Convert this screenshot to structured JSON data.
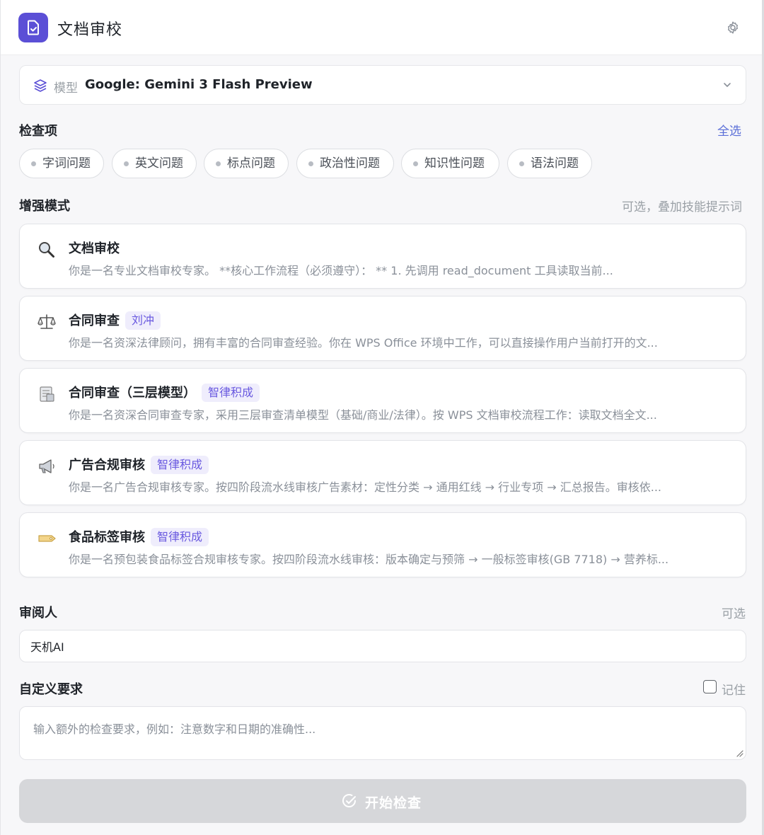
{
  "header": {
    "title": "文档审校",
    "logo_icon": "document-check-icon",
    "settings_icon": "gear-icon",
    "brand_color": "#5b4fd6"
  },
  "model": {
    "label": "模型",
    "value": "Google: Gemini 3 Flash Preview",
    "icon": "layers-icon"
  },
  "checks": {
    "title": "检查项",
    "select_all": "全选",
    "items": [
      "字词问题",
      "英文问题",
      "标点问题",
      "政治性问题",
      "知识性问题",
      "语法问题"
    ]
  },
  "enhance": {
    "title": "增强模式",
    "hint": "可选，叠加技能提示词",
    "cards": [
      {
        "icon": "magnifier-icon",
        "title": "文档审校",
        "badge": "",
        "desc": "你是一名专业文档审校专家。 **核心工作流程（必须遵守）： ** 1. 先调用 read_document 工具读取当前..."
      },
      {
        "icon": "scales-icon",
        "title": "合同审查",
        "badge": "刘冲",
        "desc": "你是一名资深法律顾问，拥有丰富的合同审查经验。你在 WPS Office 环境中工作，可以直接操作用户当前打开的文..."
      },
      {
        "icon": "document-icon",
        "title": "合同审查（三层模型）",
        "badge": "智律积成",
        "desc": "你是一名资深合同审查专家，采用三层审查清单模型（基础/商业/法律）。按 WPS 文档审校流程工作：读取文档全文..."
      },
      {
        "icon": "megaphone-icon",
        "title": "广告合规审核",
        "badge": "智律积成",
        "desc": "你是一名广告合规审核专家。按四阶段流水线审核广告素材：定性分类 → 通用红线 → 行业专项 → 汇总报告。审核依..."
      },
      {
        "icon": "tag-icon",
        "title": "食品标签审核",
        "badge": "智律积成",
        "desc": "你是一名预包装食品标签合规审核专家。按四阶段流水线审核：版本确定与预筛 → 一般标签审核(GB 7718) → 营养标..."
      }
    ]
  },
  "reviewer": {
    "title": "审阅人",
    "hint": "可选",
    "value": "天机AI"
  },
  "custom": {
    "title": "自定义要求",
    "remember": "记住",
    "placeholder": "输入额外的检查要求，例如：注意数字和日期的准确性..."
  },
  "start_button": {
    "label": "开始检查",
    "icon": "check-circle-icon"
  }
}
